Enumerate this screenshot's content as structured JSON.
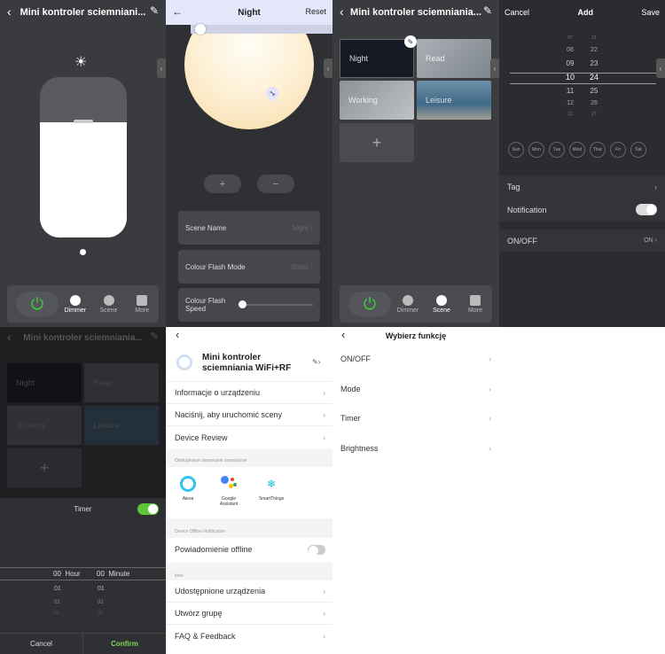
{
  "screen1": {
    "title": "Mini kontroler sciemniani...",
    "tabs": [
      {
        "label": "Dimmer"
      },
      {
        "label": "Scene"
      },
      {
        "label": "More"
      }
    ]
  },
  "screen2": {
    "title": "Night",
    "reset": "Reset",
    "marker": "1",
    "plus": "+",
    "minus": "−",
    "rows": [
      {
        "label": "Scene Name",
        "value": "Night"
      },
      {
        "label": "Colour Flash Mode",
        "value": "Static"
      },
      {
        "label": "Colour Flash Speed",
        "value": ""
      }
    ]
  },
  "screen3": {
    "title": "Mini kontroler sciemniania...",
    "scenes": [
      "Night",
      "Read",
      "Working",
      "Leisure"
    ],
    "add": "+",
    "tabs": [
      {
        "label": "Dimmer"
      },
      {
        "label": "Scene"
      },
      {
        "label": "More"
      }
    ]
  },
  "screen4": {
    "cancel": "Cancel",
    "title": "Add",
    "save": "Save",
    "hours": [
      "07",
      "08",
      "09",
      "10",
      "11",
      "12",
      "13"
    ],
    "minutes": [
      "21",
      "22",
      "23",
      "24",
      "25",
      "26",
      "27"
    ],
    "days": [
      "Sun",
      "Mon",
      "Tue",
      "Wed",
      "Thur",
      "Fri",
      "Sat"
    ],
    "tag": "Tag",
    "notification": "Notification",
    "onoff": "ON/OFF",
    "onoff_value": "ON"
  },
  "screen5": {
    "title": "Mini kontroler sciemniania...",
    "scenes": [
      "Night",
      "Read",
      "Working",
      "Leisure"
    ],
    "timer": "Timer",
    "hour_val": "00",
    "hour_label": "Hour",
    "min_val": "00",
    "min_label": "Minute",
    "next1": "01",
    "next2": "02",
    "next3": "03",
    "cancel": "Cancel",
    "confirm": "Confirm"
  },
  "screen6": {
    "device_name": "Mini kontroler sciemniania WiFi+RF",
    "rows1": [
      "Informacje o urządzeniu",
      "Naciśnij, aby uruchomić sceny",
      "Device Review"
    ],
    "ext_header": "Obsługiwane sterowanie zewnętrzne",
    "assistants": [
      "Alexa",
      "Google Assistant",
      "SmartThings"
    ],
    "offline_header": "Device Offline Notification",
    "offline_label": "Powiadomienie offline",
    "other_header": "Inne",
    "rows2": [
      "Udostępnione urządzenia",
      "Utwórz grupę",
      "FAQ & Feedback"
    ]
  },
  "screen7": {
    "title": "Wybierz funkcję",
    "rows": [
      "ON/OFF",
      "Mode",
      "Timer",
      "Brightness"
    ]
  },
  "colors": {
    "power_green": "#39d339",
    "toggle_green": "#5ec63a",
    "confirm_green": "#7ed957"
  }
}
